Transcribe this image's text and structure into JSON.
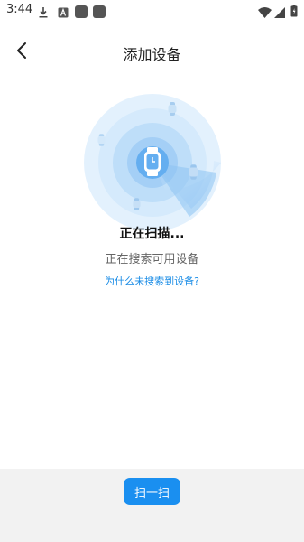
{
  "status_bar": {
    "time": "3:44",
    "icons": [
      "download-icon",
      "a-app-icon",
      "app-square-icon",
      "app-square-icon",
      "wifi-icon",
      "signal-icon",
      "battery-icon"
    ]
  },
  "header": {
    "title": "添加设备",
    "back_icon": "chevron-left-icon"
  },
  "scan": {
    "title": "正在扫描...",
    "subtitle": "正在搜索可用设备",
    "help_link": "为什么未搜索到设备?",
    "center_icon": "smartwatch-icon"
  },
  "footer": {
    "scan_button": "扫一扫"
  },
  "colors": {
    "accent": "#1a8ff0",
    "link": "#1a8ce6",
    "radar_light": "#e3f1fd",
    "radar_mid": "#cfe6fb",
    "radar_inner": "#a9d2f7",
    "radar_core": "#64aef0"
  }
}
